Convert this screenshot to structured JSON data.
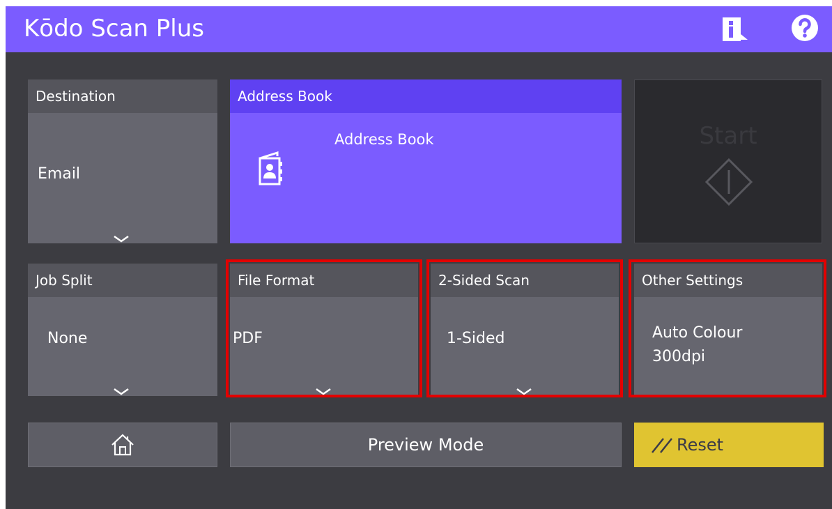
{
  "app": {
    "title": "Kōdo Scan Plus"
  },
  "tiles": {
    "destination": {
      "header": "Destination",
      "value": "Email"
    },
    "address_book": {
      "header": "Address Book",
      "label": "Address Book"
    },
    "start": {
      "label": "Start"
    },
    "job_split": {
      "header": "Job Split",
      "value": "None"
    },
    "file_format": {
      "header": "File Format",
      "value": "PDF"
    },
    "two_sided": {
      "header": "2-Sided Scan",
      "value": "1-Sided"
    },
    "other": {
      "header": "Other Settings",
      "value_line1": "Auto Colour",
      "value_line2": "300dpi"
    }
  },
  "buttons": {
    "preview": "Preview Mode",
    "reset": "Reset"
  },
  "icons": {
    "info": "info-icon",
    "help": "help-icon",
    "address_book": "address-book-icon",
    "start": "start-diamond-icon",
    "home": "home-icon",
    "reset": "eraser-icon",
    "chevron": "chevron-down-icon"
  },
  "colors": {
    "titlebar": "#7b5cff",
    "accent": "#5f41f2",
    "background": "#3c3c41",
    "tile": "#66666f",
    "tile_header": "#55555c",
    "reset": "#e0c431",
    "highlight": "#e30000"
  }
}
